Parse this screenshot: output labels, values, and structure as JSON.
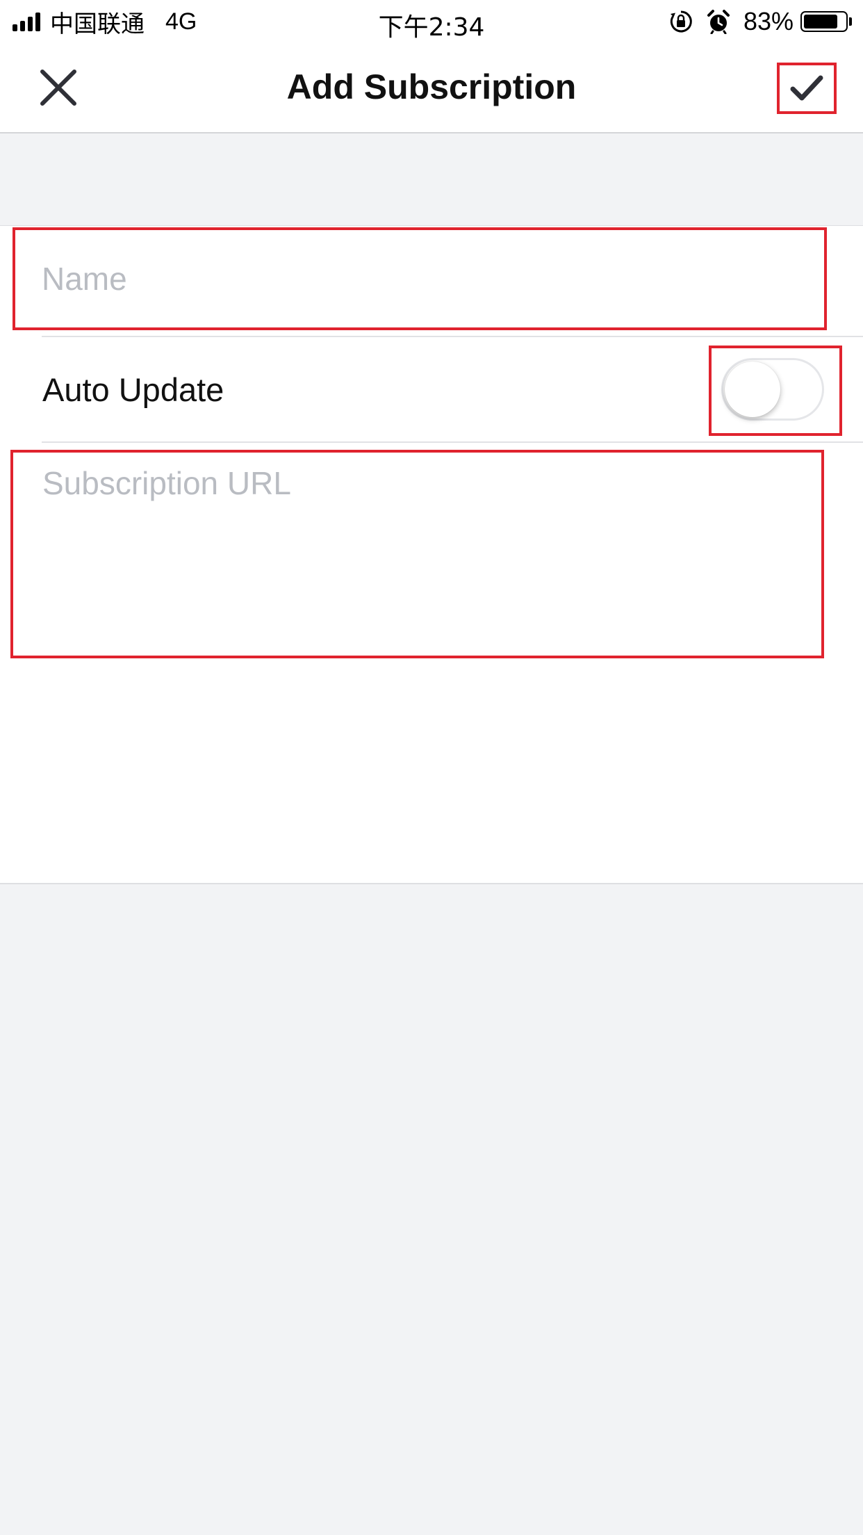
{
  "status_bar": {
    "carrier": "中国联通",
    "network": "4G",
    "time": "下午2:34",
    "battery_percent_label": "83%",
    "battery_level": 0.83,
    "signal_bars": 4,
    "icons": [
      "signal-icon",
      "lock-rotation-icon",
      "alarm-icon",
      "battery-icon"
    ]
  },
  "nav": {
    "title": "Add Subscription",
    "close_icon": "close-icon",
    "confirm_icon": "checkmark-icon"
  },
  "form": {
    "name": {
      "value": "",
      "placeholder": "Name"
    },
    "auto_update": {
      "label": "Auto Update",
      "enabled": false
    },
    "subscription_url": {
      "value": "",
      "placeholder": "Subscription URL"
    }
  },
  "colors": {
    "highlight_border": "#e0232e",
    "background": "#f2f3f5",
    "placeholder": "#b9bcc2",
    "icon": "#2f3037"
  }
}
